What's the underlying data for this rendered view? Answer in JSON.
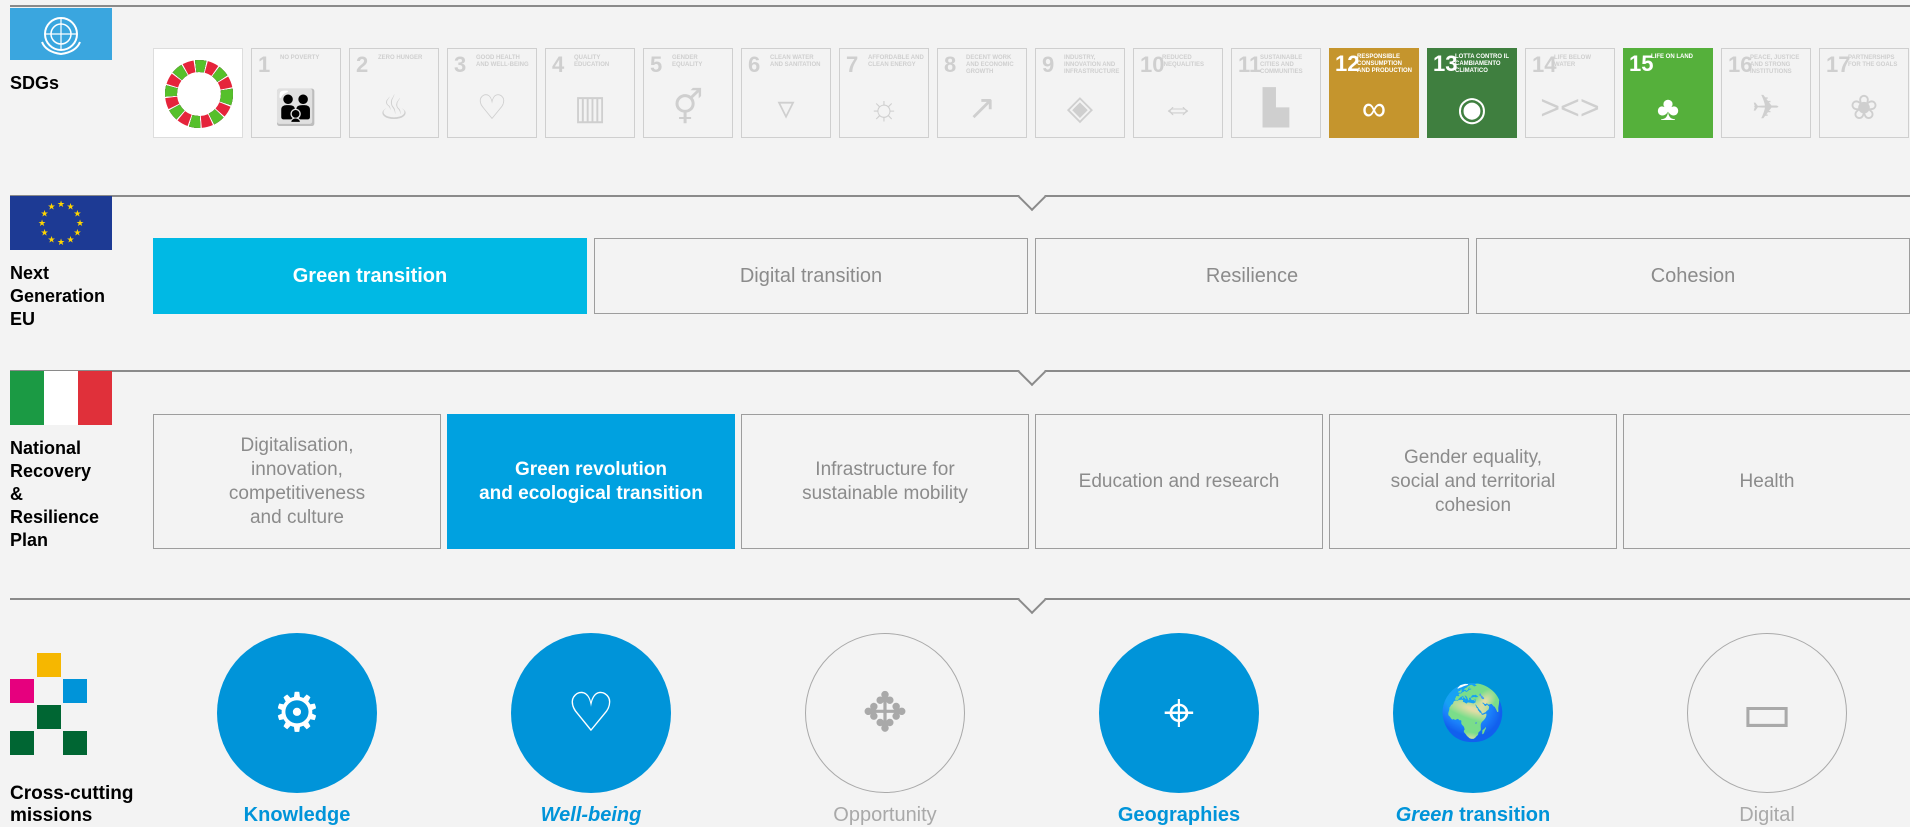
{
  "colors": {
    "sdg12": "#c5952d",
    "sdg13": "#3f7f3f",
    "sdg15": "#55b03b",
    "green_transition_eu": "#00b9e4",
    "green_revolution": "#00a1e0",
    "mission_active": "#0094d9",
    "inactive": "#a9a9a9"
  },
  "rows": {
    "sdgs": "SDGs",
    "ngeu": "Next\nGeneration\nEU",
    "pnrr": "National\nRecovery\n&\nResilience\nPlan",
    "missions": "Cross-cutting\nmissions"
  },
  "sdgs": [
    {
      "num": "1",
      "title": "No poverty",
      "active": false,
      "icon": "people-icon"
    },
    {
      "num": "2",
      "title": "Zero hunger",
      "active": false,
      "icon": "bowl-icon"
    },
    {
      "num": "3",
      "title": "Good health and well-being",
      "active": false,
      "icon": "heartbeat-icon"
    },
    {
      "num": "4",
      "title": "Quality education",
      "active": false,
      "icon": "book-icon"
    },
    {
      "num": "5",
      "title": "Gender equality",
      "active": false,
      "icon": "gender-icon"
    },
    {
      "num": "6",
      "title": "Clean water and sanitation",
      "active": false,
      "icon": "water-icon"
    },
    {
      "num": "7",
      "title": "Affordable and clean energy",
      "active": false,
      "icon": "sun-icon"
    },
    {
      "num": "8",
      "title": "Decent work and economic growth",
      "active": false,
      "icon": "growth-icon"
    },
    {
      "num": "9",
      "title": "Industry, innovation and infrastructure",
      "active": false,
      "icon": "cubes-icon"
    },
    {
      "num": "10",
      "title": "Reduced inequalities",
      "active": false,
      "icon": "equal-icon"
    },
    {
      "num": "11",
      "title": "Sustainable cities and communities",
      "active": false,
      "icon": "city-icon"
    },
    {
      "num": "12",
      "title": "Responsible consumption and production",
      "active": true,
      "icon": "infinity-icon"
    },
    {
      "num": "13",
      "title": "Lotta contro il cambiamento climatico",
      "active": true,
      "icon": "eye-icon"
    },
    {
      "num": "14",
      "title": "Life below water",
      "active": false,
      "icon": "fish-icon"
    },
    {
      "num": "15",
      "title": "Life on land",
      "active": true,
      "icon": "tree-icon"
    },
    {
      "num": "16",
      "title": "Peace, justice and strong institutions",
      "active": false,
      "icon": "dove-icon"
    },
    {
      "num": "17",
      "title": "Partnerships for the goals",
      "active": false,
      "icon": "rings-icon"
    }
  ],
  "ngeu": [
    {
      "label": "Green transition",
      "selected": true
    },
    {
      "label": "Digital transition",
      "selected": false
    },
    {
      "label": "Resilience",
      "selected": false
    },
    {
      "label": "Cohesion",
      "selected": false
    }
  ],
  "pnrr": [
    {
      "label": "Digitalisation,\ninnovation,\ncompetitiveness\nand culture",
      "selected": false
    },
    {
      "label": "Green revolution\nand ecological transition",
      "selected": true
    },
    {
      "label": "Infrastructure for\nsustainable mobility",
      "selected": false
    },
    {
      "label": "Education and research",
      "selected": false
    },
    {
      "label": "Gender equality,\nsocial and territorial\ncohesion",
      "selected": false
    },
    {
      "label": "Health",
      "selected": false
    }
  ],
  "missions": [
    {
      "label_em": "",
      "label": "Knowledge",
      "active": true,
      "icon": "head-gears-icon"
    },
    {
      "label_em": "Well-being",
      "label": "",
      "active": true,
      "icon": "hand-heart-icon"
    },
    {
      "label_em": "",
      "label": "Opportunity",
      "active": false,
      "icon": "person-arrows-icon"
    },
    {
      "label_em": "",
      "label": "Geographies",
      "active": true,
      "icon": "map-pin-icon"
    },
    {
      "label_em": "Green",
      "label": " transition",
      "active": true,
      "icon": "globe-leaf-icon"
    },
    {
      "label_em": "",
      "label": "Digital",
      "active": false,
      "icon": "monitor-person-icon"
    }
  ]
}
